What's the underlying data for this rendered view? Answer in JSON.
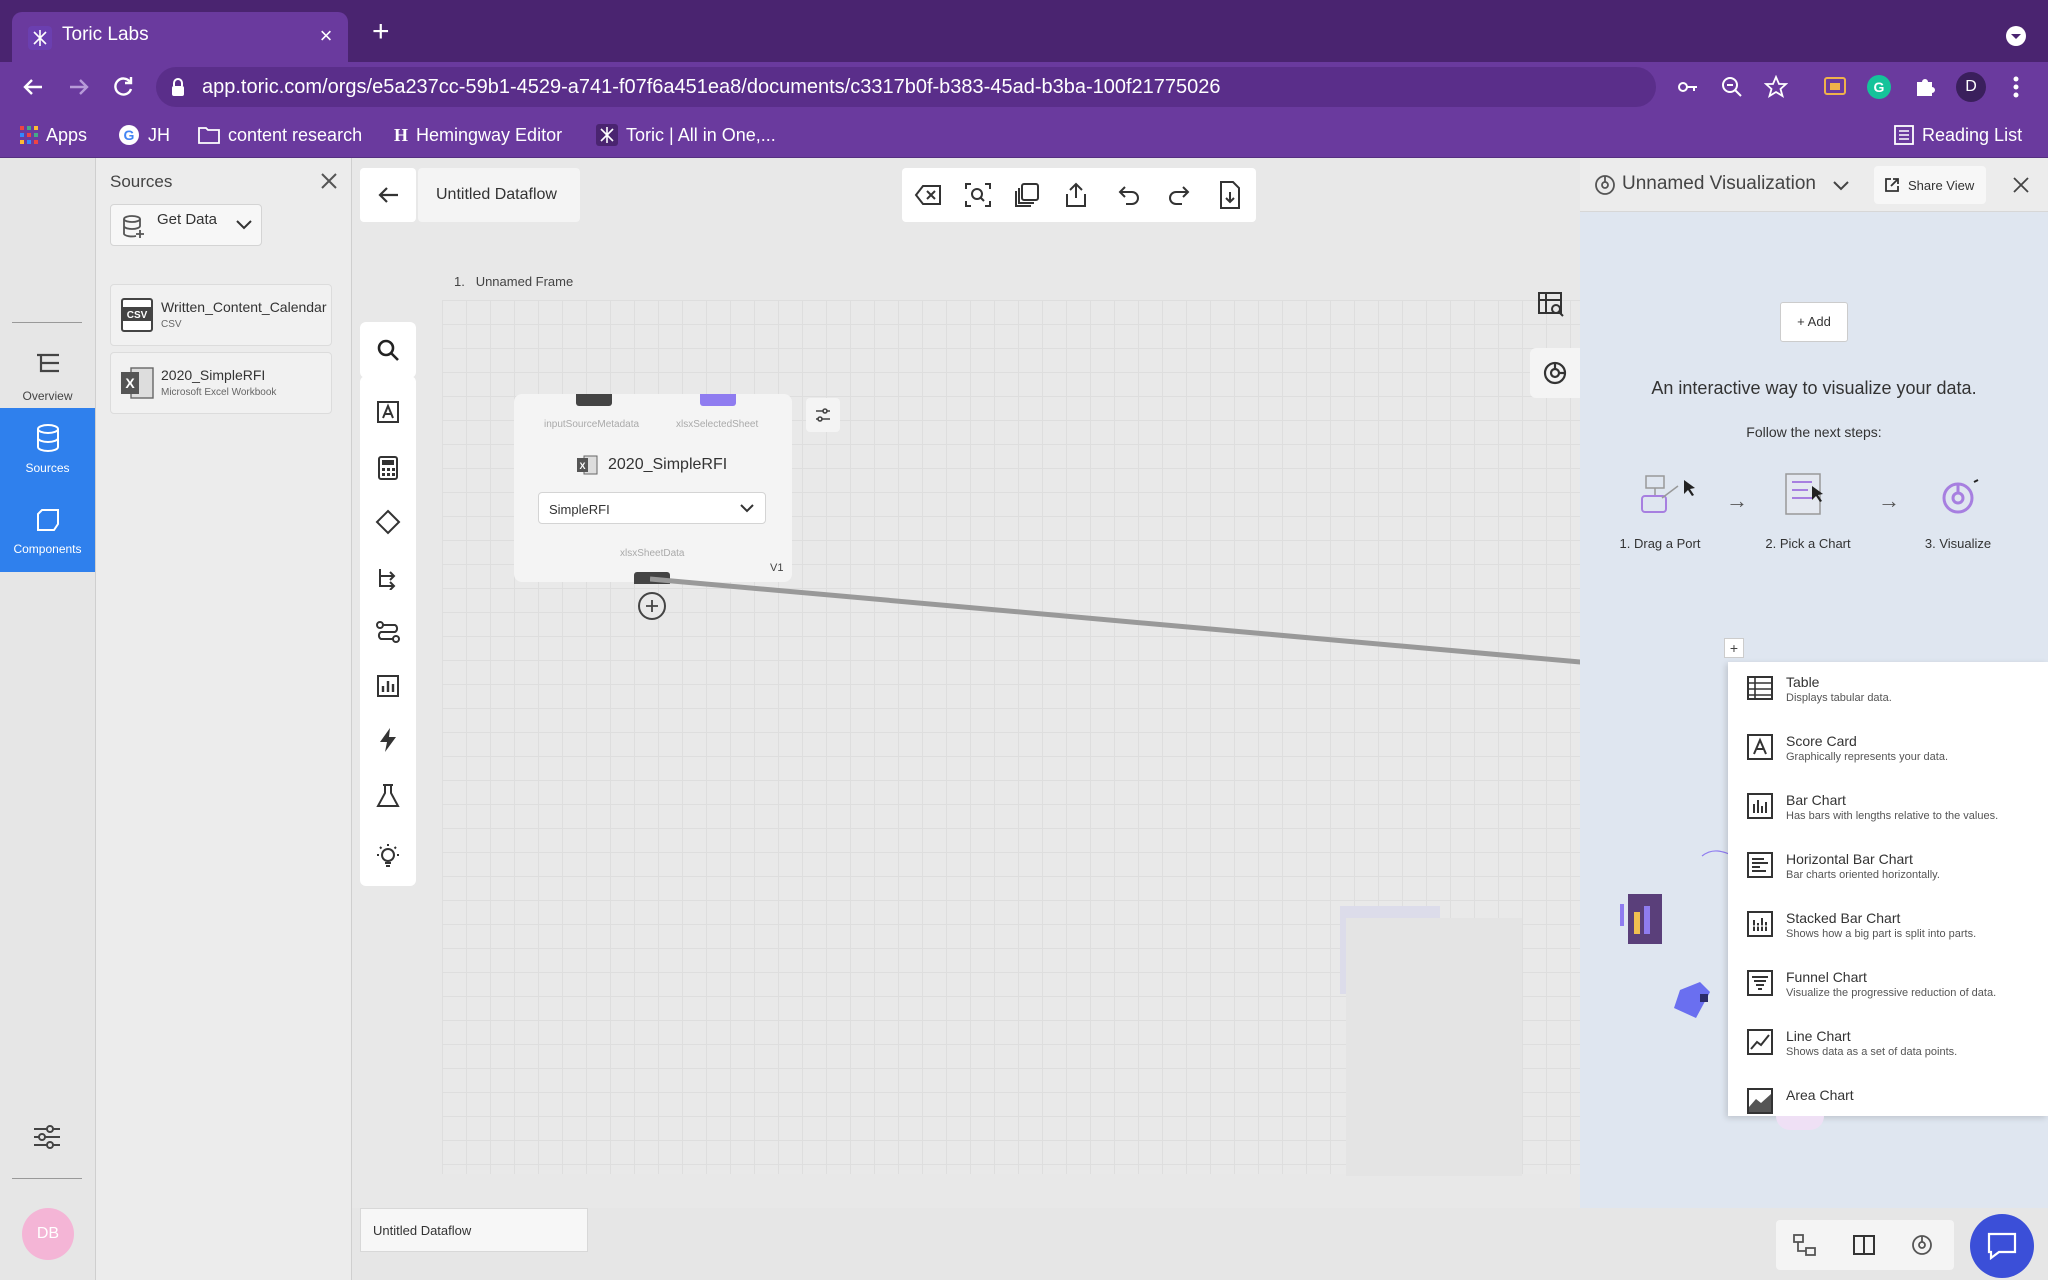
{
  "browser": {
    "tab_title": "Toric Labs",
    "url": "app.toric.com/orgs/e5a237cc-59b1-4529-a741-f07f6a451ea8/documents/c3317b0f-b383-45ad-b3ba-100f21775026",
    "profile_initial": "D",
    "bookmarks": [
      "Apps",
      "JH",
      "content research",
      "Hemingway Editor",
      "Toric | All in One,..."
    ],
    "reading_list": "Reading List"
  },
  "rail": {
    "items": [
      {
        "label": "Overview"
      },
      {
        "label": "Sources"
      },
      {
        "label": "Components"
      }
    ],
    "avatar": "DB"
  },
  "sources": {
    "title": "Sources",
    "get_data": "Get Data",
    "files": [
      {
        "name": "Written_Content_Calendar",
        "type": "CSV",
        "badge": "CSV"
      },
      {
        "name": "2020_SimpleRFI",
        "type": "Microsoft Excel Workbook",
        "badge": "X"
      }
    ]
  },
  "canvas": {
    "dataflow_title": "Untitled Dataflow",
    "frame_index": "1.",
    "frame_name": "Unnamed Frame",
    "node": {
      "port_in_1": "inputSourceMetadata",
      "port_in_2": "xlsxSelectedSheet",
      "title": "2020_SimpleRFI",
      "sheet": "SimpleRFI",
      "port_out": "xlsxSheetData",
      "version": "V1"
    },
    "footer_tab": "Untitled Dataflow"
  },
  "visualization": {
    "title": "Unnamed Visualization",
    "share_label": "Share View",
    "add_label": "Add",
    "headline": "An interactive way to visualize your data.",
    "subhead": "Follow the next steps:",
    "steps": [
      "1. Drag a Port",
      "2. Pick a Chart",
      "3. Visualize"
    ],
    "chart_types": [
      {
        "name": "Table",
        "desc": "Displays tabular data."
      },
      {
        "name": "Score Card",
        "desc": "Graphically represents your data."
      },
      {
        "name": "Bar Chart",
        "desc": "Has bars with lengths relative to the values."
      },
      {
        "name": "Horizontal Bar Chart",
        "desc": "Bar charts oriented horizontally."
      },
      {
        "name": "Stacked Bar Chart",
        "desc": "Shows how a big part is split into parts."
      },
      {
        "name": "Funnel Chart",
        "desc": "Visualize the progressive reduction of data."
      },
      {
        "name": "Line Chart",
        "desc": "Shows data as a set of data points."
      },
      {
        "name": "Area Chart",
        "desc": ""
      }
    ]
  },
  "colors": {
    "browser_tabbar": "#4a2470",
    "browser_toolbar": "#6a3a9e",
    "active_rail": "#2f80ed",
    "accent_purple": "#8f7cf0"
  }
}
